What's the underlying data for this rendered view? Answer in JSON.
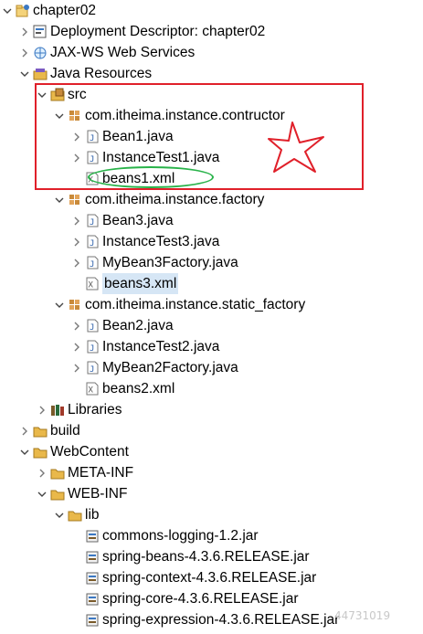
{
  "tree": [
    {
      "depth": 0,
      "expanded": true,
      "icon": "project-icon",
      "label": "chapter02"
    },
    {
      "depth": 1,
      "expanded": false,
      "icon": "deployment-descriptor-icon",
      "label": "Deployment Descriptor: chapter02"
    },
    {
      "depth": 1,
      "expanded": false,
      "icon": "web-services-icon",
      "label": "JAX-WS Web Services"
    },
    {
      "depth": 1,
      "expanded": true,
      "icon": "java-resources-icon",
      "label": "Java Resources"
    },
    {
      "depth": 2,
      "expanded": true,
      "icon": "source-folder-icon",
      "label": "src"
    },
    {
      "depth": 3,
      "expanded": true,
      "icon": "package-icon",
      "label": "com.itheima.instance.contructor"
    },
    {
      "depth": 4,
      "expanded": false,
      "icon": "java-file-icon",
      "label": "Bean1.java"
    },
    {
      "depth": 4,
      "expanded": false,
      "icon": "java-file-icon",
      "label": "InstanceTest1.java"
    },
    {
      "depth": 4,
      "expanded": null,
      "icon": "xml-file-icon",
      "label": "beans1.xml"
    },
    {
      "depth": 3,
      "expanded": true,
      "icon": "package-icon",
      "label": "com.itheima.instance.factory"
    },
    {
      "depth": 4,
      "expanded": false,
      "icon": "java-file-icon",
      "label": "Bean3.java"
    },
    {
      "depth": 4,
      "expanded": false,
      "icon": "java-file-icon",
      "label": "InstanceTest3.java"
    },
    {
      "depth": 4,
      "expanded": false,
      "icon": "java-file-icon",
      "label": "MyBean3Factory.java"
    },
    {
      "depth": 4,
      "expanded": null,
      "icon": "xml-file-icon",
      "label": "beans3.xml",
      "selected": true
    },
    {
      "depth": 3,
      "expanded": true,
      "icon": "package-icon",
      "label": "com.itheima.instance.static_factory"
    },
    {
      "depth": 4,
      "expanded": false,
      "icon": "java-file-icon",
      "label": "Bean2.java"
    },
    {
      "depth": 4,
      "expanded": false,
      "icon": "java-file-icon",
      "label": "InstanceTest2.java"
    },
    {
      "depth": 4,
      "expanded": false,
      "icon": "java-file-icon",
      "label": "MyBean2Factory.java"
    },
    {
      "depth": 4,
      "expanded": null,
      "icon": "xml-file-icon",
      "label": "beans2.xml"
    },
    {
      "depth": 2,
      "expanded": false,
      "icon": "library-icon",
      "label": "Libraries"
    },
    {
      "depth": 1,
      "expanded": false,
      "icon": "folder-icon",
      "label": "build"
    },
    {
      "depth": 1,
      "expanded": true,
      "icon": "folder-icon",
      "label": "WebContent"
    },
    {
      "depth": 2,
      "expanded": false,
      "icon": "folder-icon",
      "label": "META-INF"
    },
    {
      "depth": 2,
      "expanded": true,
      "icon": "folder-icon",
      "label": "WEB-INF"
    },
    {
      "depth": 3,
      "expanded": true,
      "icon": "folder-icon",
      "label": "lib"
    },
    {
      "depth": 4,
      "expanded": null,
      "icon": "jar-file-icon",
      "label": "commons-logging-1.2.jar"
    },
    {
      "depth": 4,
      "expanded": null,
      "icon": "jar-file-icon",
      "label": "spring-beans-4.3.6.RELEASE.jar"
    },
    {
      "depth": 4,
      "expanded": null,
      "icon": "jar-file-icon",
      "label": "spring-context-4.3.6.RELEASE.jar"
    },
    {
      "depth": 4,
      "expanded": null,
      "icon": "jar-file-icon",
      "label": "spring-core-4.3.6.RELEASE.jar"
    },
    {
      "depth": 4,
      "expanded": null,
      "icon": "jar-file-icon",
      "label": "spring-expression-4.3.6.RELEASE.jar"
    }
  ],
  "annotations": {
    "highlight_color": "#e0202a",
    "circle_color": "#29b34a",
    "star_color": "#e0202a"
  },
  "watermark": "44731019",
  "colors": {
    "selection": "#d6e6f5",
    "package": "#c98a3a",
    "folder": "#e9b84a",
    "java": "#6a6a6a"
  }
}
